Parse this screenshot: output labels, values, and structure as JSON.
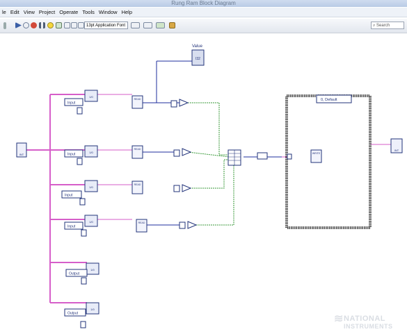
{
  "window": {
    "title": "Rung Ram Block Diagram"
  },
  "menu": [
    "le",
    "Edit",
    "View",
    "Project",
    "Operate",
    "Tools",
    "Window",
    "Help"
  ],
  "toolbar": {
    "font_selector": "13pt Application Font",
    "search_placeholder": "Search",
    "icons": [
      "run-arrow-icon",
      "run-continuous-icon",
      "abort-icon",
      "pause-icon",
      "highlight-execution-icon",
      "retain-wire-values-icon",
      "step-into-icon",
      "step-over-icon",
      "step-out-icon",
      "text-settings-icon",
      "align-objects-icon",
      "distribute-objects-icon",
      "reorder-icon",
      "cleanup-diagram-icon"
    ]
  },
  "diagram": {
    "value_indicator": {
      "label": "Value",
      "text": "I32"
    },
    "device_ref": {
      "text": "INT"
    },
    "modes": [
      "Input",
      "Input",
      "Input",
      "Input",
      "Output",
      "Output"
    ],
    "read_labels": [
      "READ",
      "READ",
      "READ",
      "READ"
    ],
    "ctrl_text": "1/0",
    "const_text": "0",
    "case_selector": "0, Default",
    "write_label": "WRITE",
    "out_ref": {
      "text": "INT"
    }
  },
  "watermark": {
    "line1": "NATIONAL",
    "line2": "INSTRUMENTS"
  }
}
